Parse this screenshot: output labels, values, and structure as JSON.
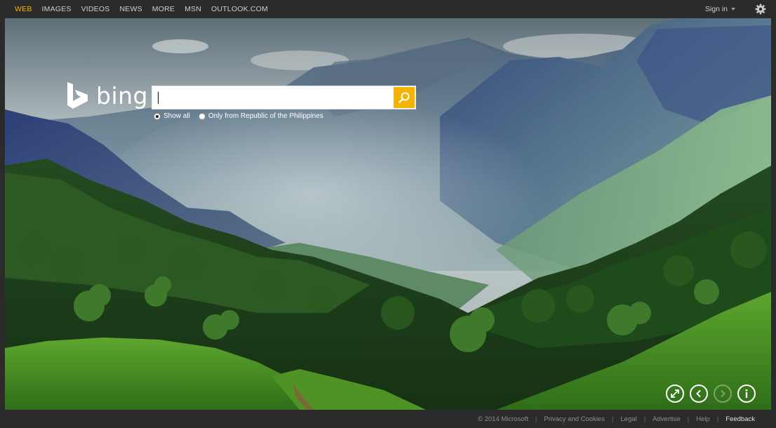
{
  "nav": {
    "items": [
      {
        "label": "WEB",
        "active": true
      },
      {
        "label": "IMAGES"
      },
      {
        "label": "VIDEOS"
      },
      {
        "label": "NEWS"
      },
      {
        "label": "MORE"
      },
      {
        "label": "MSN"
      },
      {
        "label": "OUTLOOK.COM"
      }
    ],
    "signin_label": "Sign in"
  },
  "brand": {
    "logo_text": "bing",
    "accent_color": "#f4b400"
  },
  "search": {
    "value": "",
    "placeholder": "",
    "button_icon": "search-icon",
    "scopes": [
      {
        "label": "Show all",
        "checked": true
      },
      {
        "label": "Only from Republic of the Philippines",
        "checked": false
      }
    ]
  },
  "controls": {
    "icons": [
      "expand-icon",
      "previous-icon",
      "next-icon",
      "info-icon"
    ]
  },
  "footer": {
    "copyright": "© 2014 Microsoft",
    "links": [
      "Privacy and Cookies",
      "Legal",
      "Advertise",
      "Help"
    ],
    "feedback": "Feedback"
  }
}
